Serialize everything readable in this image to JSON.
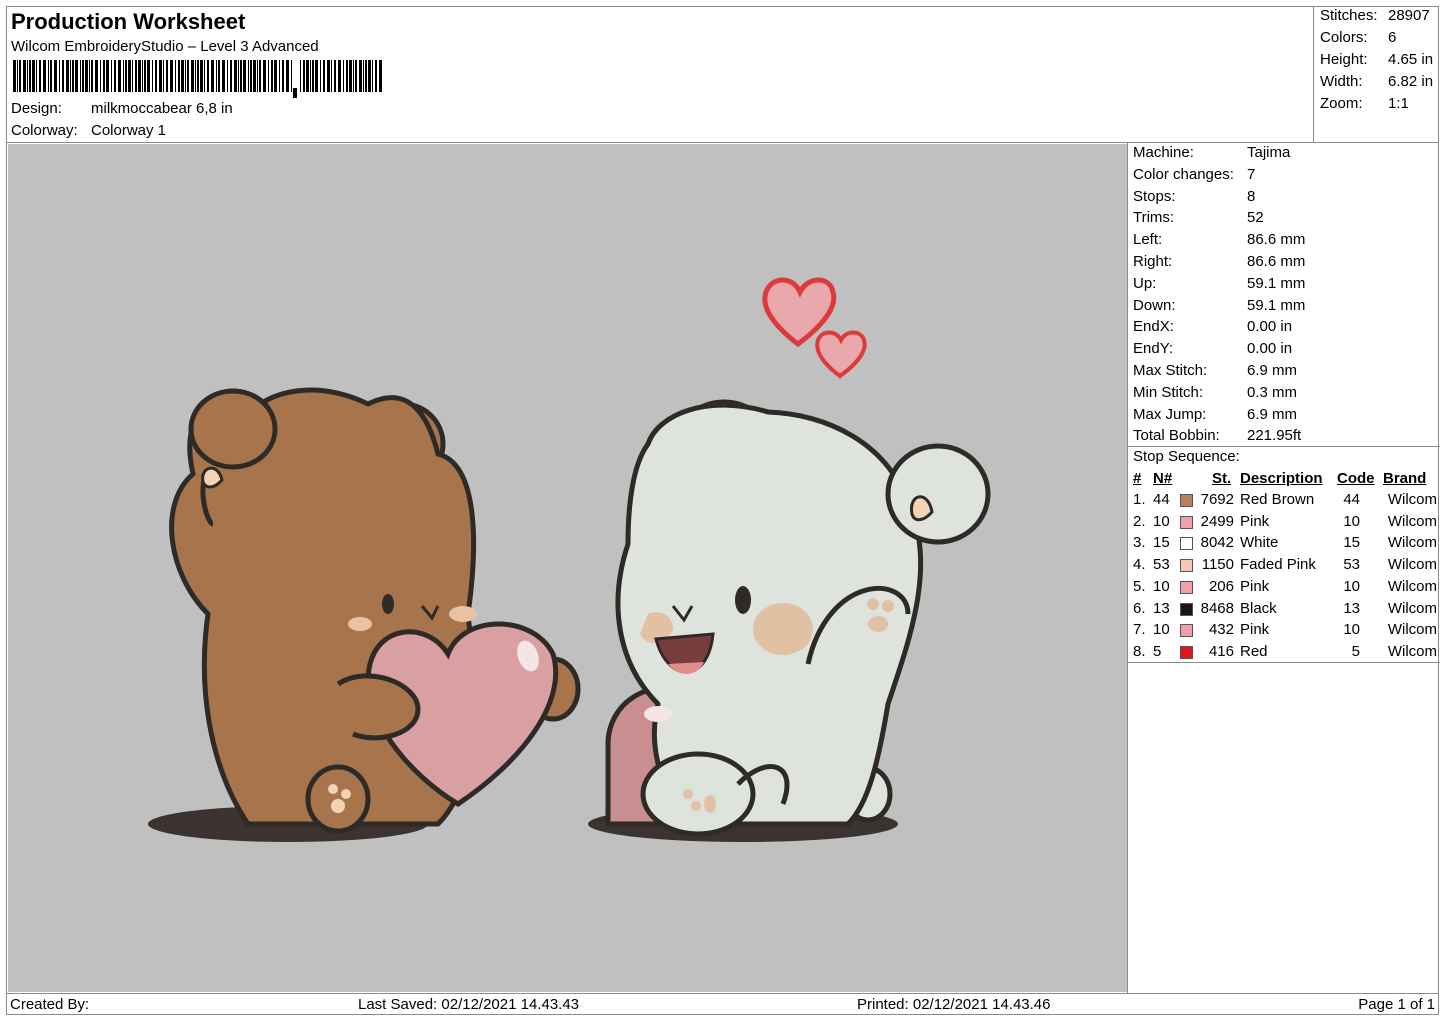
{
  "header": {
    "title": "Production Worksheet",
    "software": "Wilcom EmbroideryStudio – Level 3 Advanced",
    "design_label": "Design:",
    "design_value": "milkmoccabear 6,8 in",
    "colorway_label": "Colorway:",
    "colorway_value": "Colorway 1"
  },
  "summary": {
    "stitches_label": "Stitches:",
    "stitches": "28907",
    "colors_label": "Colors:",
    "colors": "6",
    "height_label": "Height:",
    "height": "4.65 in",
    "width_label": "Width:",
    "width": "6.82 in",
    "zoom_label": "Zoom:",
    "zoom": "1:1"
  },
  "machine": [
    {
      "label": "Machine:",
      "value": "Tajima"
    },
    {
      "label": "Color changes:",
      "value": "7"
    },
    {
      "label": "Stops:",
      "value": "8"
    },
    {
      "label": "Trims:",
      "value": "52"
    },
    {
      "label": "Left:",
      "value": "86.6 mm"
    },
    {
      "label": "Right:",
      "value": "86.6 mm"
    },
    {
      "label": "Up:",
      "value": "59.1 mm"
    },
    {
      "label": "Down:",
      "value": "59.1 mm"
    },
    {
      "label": "EndX:",
      "value": "0.00 in"
    },
    {
      "label": "EndY:",
      "value": "0.00 in"
    },
    {
      "label": "Max Stitch:",
      "value": "6.9 mm"
    },
    {
      "label": "Min Stitch:",
      "value": "0.3 mm"
    },
    {
      "label": "Max Jump:",
      "value": "6.9 mm"
    },
    {
      "label": "Total Bobbin:",
      "value": "221.95ft"
    }
  ],
  "stop_sequence": {
    "title": "Stop Sequence:",
    "headers": {
      "num": "#",
      "n": "N#",
      "st": "St.",
      "desc": "Description",
      "code": "Code",
      "brand": "Brand"
    },
    "rows": [
      {
        "num": "1.",
        "n": "44",
        "color": "#b8805e",
        "st": "7692",
        "desc": "Red Brown",
        "code": "44",
        "brand": "Wilcom"
      },
      {
        "num": "2.",
        "n": "10",
        "color": "#f0a0a8",
        "st": "2499",
        "desc": "Pink",
        "code": "10",
        "brand": "Wilcom"
      },
      {
        "num": "3.",
        "n": "15",
        "color": "#ffffff",
        "st": "8042",
        "desc": "White",
        "code": "15",
        "brand": "Wilcom"
      },
      {
        "num": "4.",
        "n": "53",
        "color": "#f6c8b4",
        "st": "1150",
        "desc": "Faded Pink",
        "code": "53",
        "brand": "Wilcom"
      },
      {
        "num": "5.",
        "n": "10",
        "color": "#f0a0a8",
        "st": "206",
        "desc": "Pink",
        "code": "10",
        "brand": "Wilcom"
      },
      {
        "num": "6.",
        "n": "13",
        "color": "#1a1414",
        "st": "8468",
        "desc": "Black",
        "code": "13",
        "brand": "Wilcom"
      },
      {
        "num": "7.",
        "n": "10",
        "color": "#f0a0a8",
        "st": "432",
        "desc": "Pink",
        "code": "10",
        "brand": "Wilcom"
      },
      {
        "num": "8.",
        "n": "5",
        "color": "#e0141e",
        "st": "416",
        "desc": "Red",
        "code": "5",
        "brand": "Wilcom"
      }
    ]
  },
  "footer": {
    "created": "Created By:",
    "saved": "Last Saved: 02/12/2021 14.43.43",
    "printed": "Printed: 02/12/2021 14.43.46",
    "page": "Page 1 of 1"
  }
}
